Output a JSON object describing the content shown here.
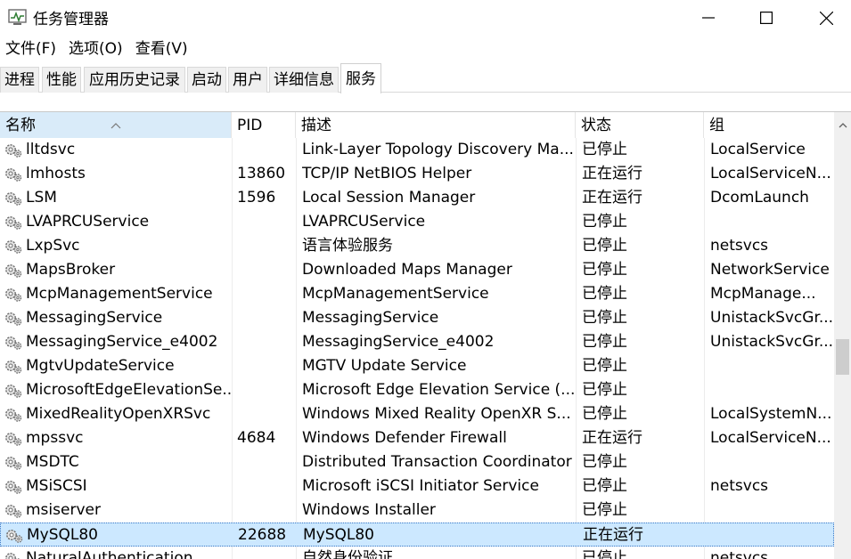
{
  "window": {
    "title": "任务管理器",
    "icons": {
      "app": "task-manager-icon",
      "minimize": "minimize-icon",
      "maximize": "maximize-icon",
      "close": "close-icon"
    }
  },
  "menu": [
    "文件(F)",
    "选项(O)",
    "查看(V)"
  ],
  "tabs": [
    {
      "label": "进程",
      "active": false
    },
    {
      "label": "性能",
      "active": false
    },
    {
      "label": "应用历史记录",
      "active": false
    },
    {
      "label": "启动",
      "active": false
    },
    {
      "label": "用户",
      "active": false
    },
    {
      "label": "详细信息",
      "active": false
    },
    {
      "label": "服务",
      "active": true
    }
  ],
  "columns": {
    "name": "名称",
    "pid": "PID",
    "description": "描述",
    "status": "状态",
    "group": "组"
  },
  "sort": {
    "column": "name",
    "direction": "ascending"
  },
  "services": [
    {
      "name": "lltdsvc",
      "pid": "",
      "description": "Link-Layer Topology Discovery Ma...",
      "status": "已停止",
      "group": "LocalService"
    },
    {
      "name": "lmhosts",
      "pid": "13860",
      "description": "TCP/IP NetBIOS Helper",
      "status": "正在运行",
      "group": "LocalServiceN..."
    },
    {
      "name": "LSM",
      "pid": "1596",
      "description": "Local Session Manager",
      "status": "正在运行",
      "group": "DcomLaunch"
    },
    {
      "name": "LVAPRCUService",
      "pid": "",
      "description": "LVAPRCUService",
      "status": "已停止",
      "group": ""
    },
    {
      "name": "LxpSvc",
      "pid": "",
      "description": "语言体验服务",
      "status": "已停止",
      "group": "netsvcs"
    },
    {
      "name": "MapsBroker",
      "pid": "",
      "description": "Downloaded Maps Manager",
      "status": "已停止",
      "group": "NetworkService"
    },
    {
      "name": "McpManagementService",
      "pid": "",
      "description": "McpManagementService",
      "status": "已停止",
      "group": "McpManage..."
    },
    {
      "name": "MessagingService",
      "pid": "",
      "description": "MessagingService",
      "status": "已停止",
      "group": "UnistackSvcGr..."
    },
    {
      "name": "MessagingService_e4002",
      "pid": "",
      "description": "MessagingService_e4002",
      "status": "已停止",
      "group": "UnistackSvcGr..."
    },
    {
      "name": "MgtvUpdateService",
      "pid": "",
      "description": "MGTV Update Service",
      "status": "已停止",
      "group": ""
    },
    {
      "name": "MicrosoftEdgeElevationSe...",
      "pid": "",
      "description": "Microsoft Edge Elevation Service (...",
      "status": "已停止",
      "group": ""
    },
    {
      "name": "MixedRealityOpenXRSvc",
      "pid": "",
      "description": "Windows Mixed Reality OpenXR S...",
      "status": "已停止",
      "group": "LocalSystemN..."
    },
    {
      "name": "mpssvc",
      "pid": "4684",
      "description": "Windows Defender Firewall",
      "status": "正在运行",
      "group": "LocalServiceN..."
    },
    {
      "name": "MSDTC",
      "pid": "",
      "description": "Distributed Transaction Coordinator",
      "status": "已停止",
      "group": ""
    },
    {
      "name": "MSiSCSI",
      "pid": "",
      "description": "Microsoft iSCSI Initiator Service",
      "status": "已停止",
      "group": "netsvcs"
    },
    {
      "name": "msiserver",
      "pid": "",
      "description": "Windows Installer",
      "status": "已停止",
      "group": ""
    },
    {
      "name": "MySQL80",
      "pid": "22688",
      "description": "MySQL80",
      "status": "正在运行",
      "group": "",
      "selected": true
    },
    {
      "name": "NaturalAuthentication",
      "pid": "",
      "description": "自然身份验证",
      "status": "已停止",
      "group": "netsvcs"
    }
  ],
  "row_icon": "service-gear-icon",
  "scrollbar": {
    "position_fraction": 0.52
  }
}
